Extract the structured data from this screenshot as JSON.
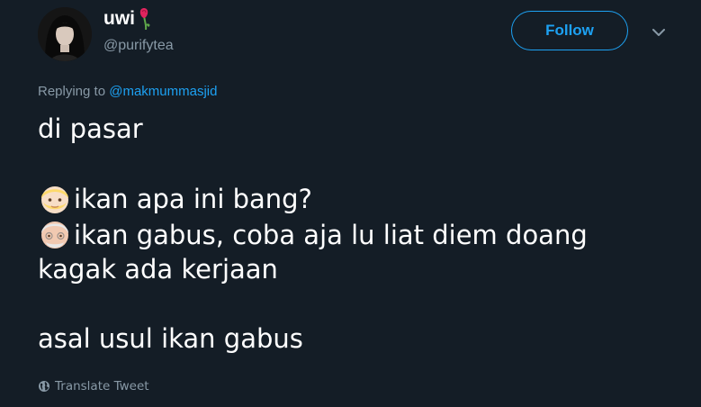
{
  "author": {
    "display_name": "uwi",
    "username": "@purifytea",
    "avatar": "avatar-photo-dark-hair",
    "badge_icon": "wilted-flower-icon"
  },
  "header": {
    "follow_label": "Follow",
    "more_icon": "chevron-down-icon"
  },
  "reply": {
    "prefix": "Replying to",
    "mention": "@makmummasjid"
  },
  "tweet": {
    "line1": "di pasar",
    "line2_emoji": "blond-man-emoji",
    "line2": "ikan apa ini bang?",
    "line3_emoji": "old-man-emoji",
    "line3": "ikan gabus, coba aja lu liat diem doang",
    "line4": "kagak ada kerjaan",
    "line5": "asal usul ikan gabus"
  },
  "footer": {
    "translate_label": "Translate Tweet",
    "translate_icon": "globe-icon"
  },
  "colors": {
    "background": "#141d26",
    "accent": "#1da1f2",
    "secondary_text": "#8899a6",
    "primary_text": "#ffffff"
  }
}
